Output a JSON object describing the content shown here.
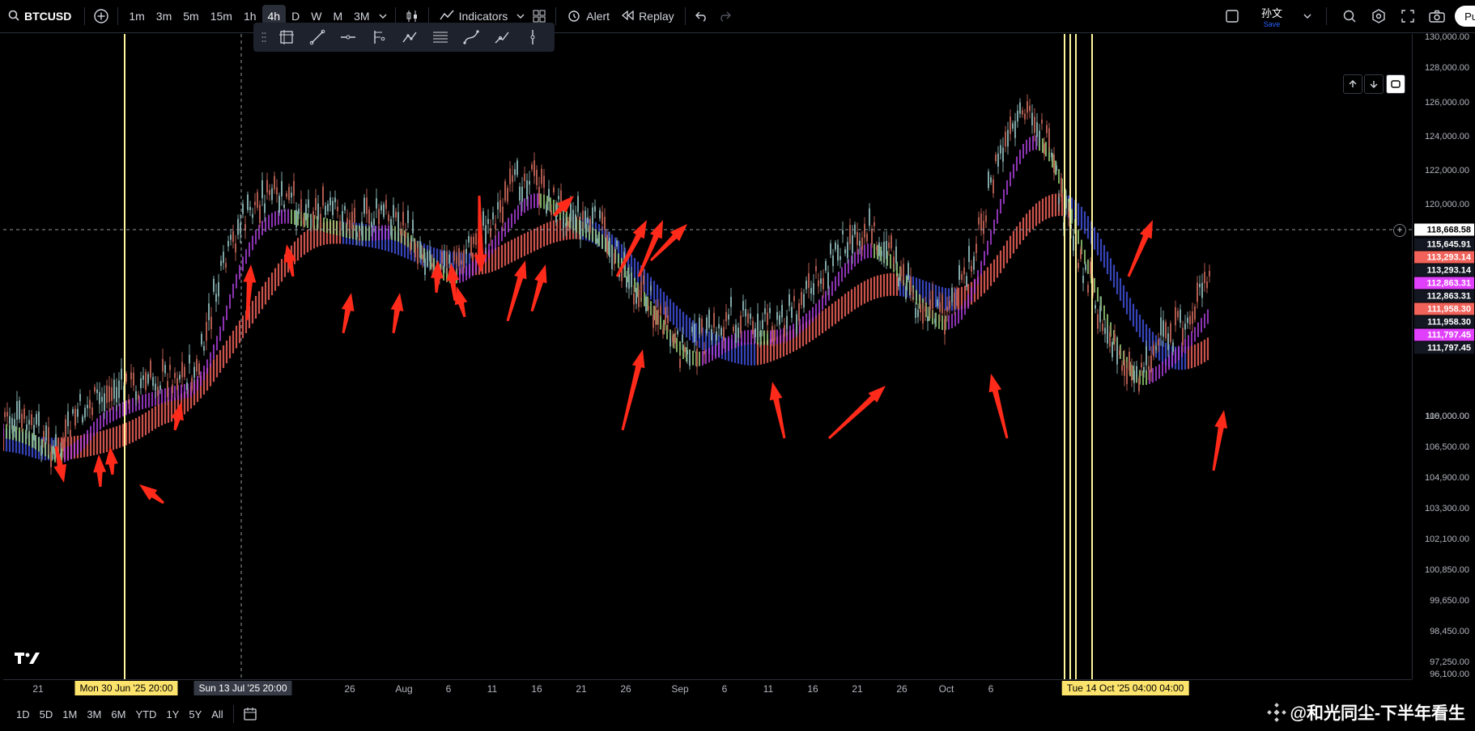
{
  "header": {
    "symbol": "BTCUSD",
    "intervals": [
      "1m",
      "3m",
      "5m",
      "15m",
      "1h",
      "4h",
      "D",
      "W",
      "M",
      "3M"
    ],
    "active_interval": "4h",
    "indicators_label": "Indicators",
    "alert_label": "Alert",
    "replay_label": "Replay",
    "layout_name": "孙文",
    "layout_status": "Save",
    "publish_label": "Pu"
  },
  "drawing_tools": [
    "frame-icon",
    "trend-line-icon",
    "horizontal-ray-icon",
    "fork-icon",
    "path-icon",
    "parallel-channel-icon",
    "curve-icon",
    "polyline-icon",
    "vertical-line-icon"
  ],
  "price_axis": {
    "ticks": [
      "130,000.00",
      "128,000.00",
      "126,000.00",
      "124,000.00",
      "122,000.00",
      "120,000.00",
      "110,000.00",
      "108,000.00",
      "106,500.00",
      "104,900.00",
      "103,300.00",
      "102,100.00",
      "100,850.00",
      "99,650.00",
      "98,450.00",
      "97,250.00",
      "96,100.00"
    ],
    "crosshair_price": "118,668.58",
    "labels": [
      {
        "text": "115,645.91",
        "color": "#131722"
      },
      {
        "text": "113,293.14",
        "color": "#f0625a"
      },
      {
        "text": "113,293.14",
        "color": "#131722"
      },
      {
        "text": "112,863.31",
        "color": "#e040fb"
      },
      {
        "text": "112,863.31",
        "color": "#131722"
      },
      {
        "text": "111,958.30",
        "color": "#f0625a"
      },
      {
        "text": "111,958.30",
        "color": "#131722"
      },
      {
        "text": "111,797.45",
        "color": "#e040fb"
      },
      {
        "text": "111,797.45",
        "color": "#131722"
      }
    ]
  },
  "time_axis": {
    "labels": [
      "21",
      "26",
      "Aug",
      "6",
      "11",
      "16",
      "21",
      "26",
      "Sep",
      "6",
      "11",
      "16",
      "21",
      "26",
      "Oct",
      "6",
      "26"
    ],
    "highlight_left": "Mon 30 Jun '25   20:00",
    "highlight_crosshair": "Sun 13 Jul '25   20:00",
    "highlight_right": "Tue 14 Oct '25   04:00   04:00"
  },
  "bottom": {
    "ranges": [
      "1D",
      "5D",
      "1M",
      "3M",
      "6M",
      "YTD",
      "1Y",
      "5Y",
      "All"
    ],
    "watermark": "@和光同尘-下半年看生"
  },
  "colors": {
    "up_candle": "#b05a4e",
    "down_candle": "#7fa6a6",
    "ribbon_red": "#f0625a",
    "ribbon_blue": "#3f51d9",
    "ribbon_purple": "#b040e0",
    "ribbon_green": "#9bd27a",
    "arrow": "#ff2a1a",
    "vline": "#fff59d"
  }
}
